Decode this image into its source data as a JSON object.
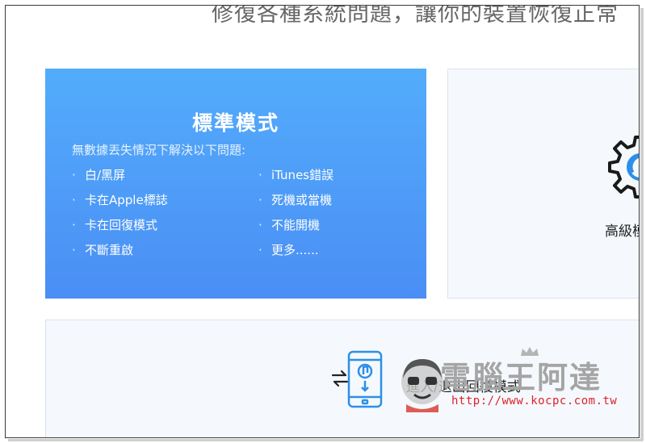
{
  "header": {
    "headline": "修復各種系統問題，讓你的裝置恢復正常"
  },
  "standard_mode": {
    "title": "標準模式",
    "subtitle": "無數據丟失情況下解決以下問題:",
    "bullet": "·",
    "issues_left": [
      "白/黑屏",
      "卡在Apple標誌",
      "卡在回復模式",
      "不斷重啟"
    ],
    "issues_right": [
      "iTunes錯誤",
      "死機或當機",
      "不能開機",
      "更多......"
    ],
    "colors": {
      "gradient_top": "#53acfb",
      "gradient_bottom": "#4a8ef5"
    }
  },
  "advanced_mode": {
    "label": "高級模式",
    "icon": "gear-icon"
  },
  "recovery": {
    "label": "進入/退出回復模式",
    "icons": [
      "arrows-exchange-icon",
      "phone-music-icon"
    ]
  },
  "watermark": {
    "logo_text": "電腦王阿達",
    "url": "http://www.kocpc.com.tw"
  }
}
